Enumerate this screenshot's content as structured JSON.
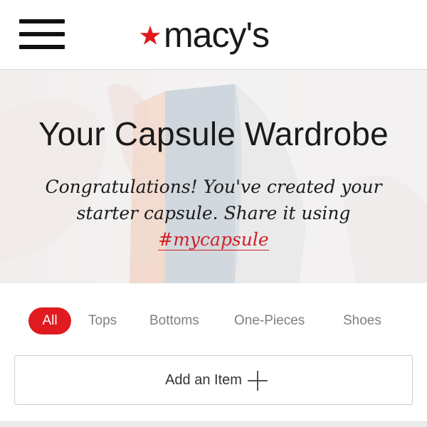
{
  "header": {
    "menu_icon": "hamburger-menu-icon",
    "logo_text": "macy's",
    "logo_star_icon": "star-icon",
    "brand_color": "#e11a20"
  },
  "hero": {
    "title": "Your Capsule Wardrobe",
    "message_part1": "Congratulations!  You've created your starter capsule. Share it using ",
    "hashtag": "#mycapsule",
    "hashtag_color": "#d12026"
  },
  "filters": {
    "active_color": "#e11a20",
    "tabs": [
      {
        "label": "All",
        "active": true
      },
      {
        "label": "Tops",
        "active": false
      },
      {
        "label": "Bottoms",
        "active": false
      },
      {
        "label": "One-Pieces",
        "active": false
      },
      {
        "label": "Shoes",
        "active": false
      }
    ]
  },
  "add_item": {
    "label": "Add an Item",
    "icon": "plus-icon"
  }
}
